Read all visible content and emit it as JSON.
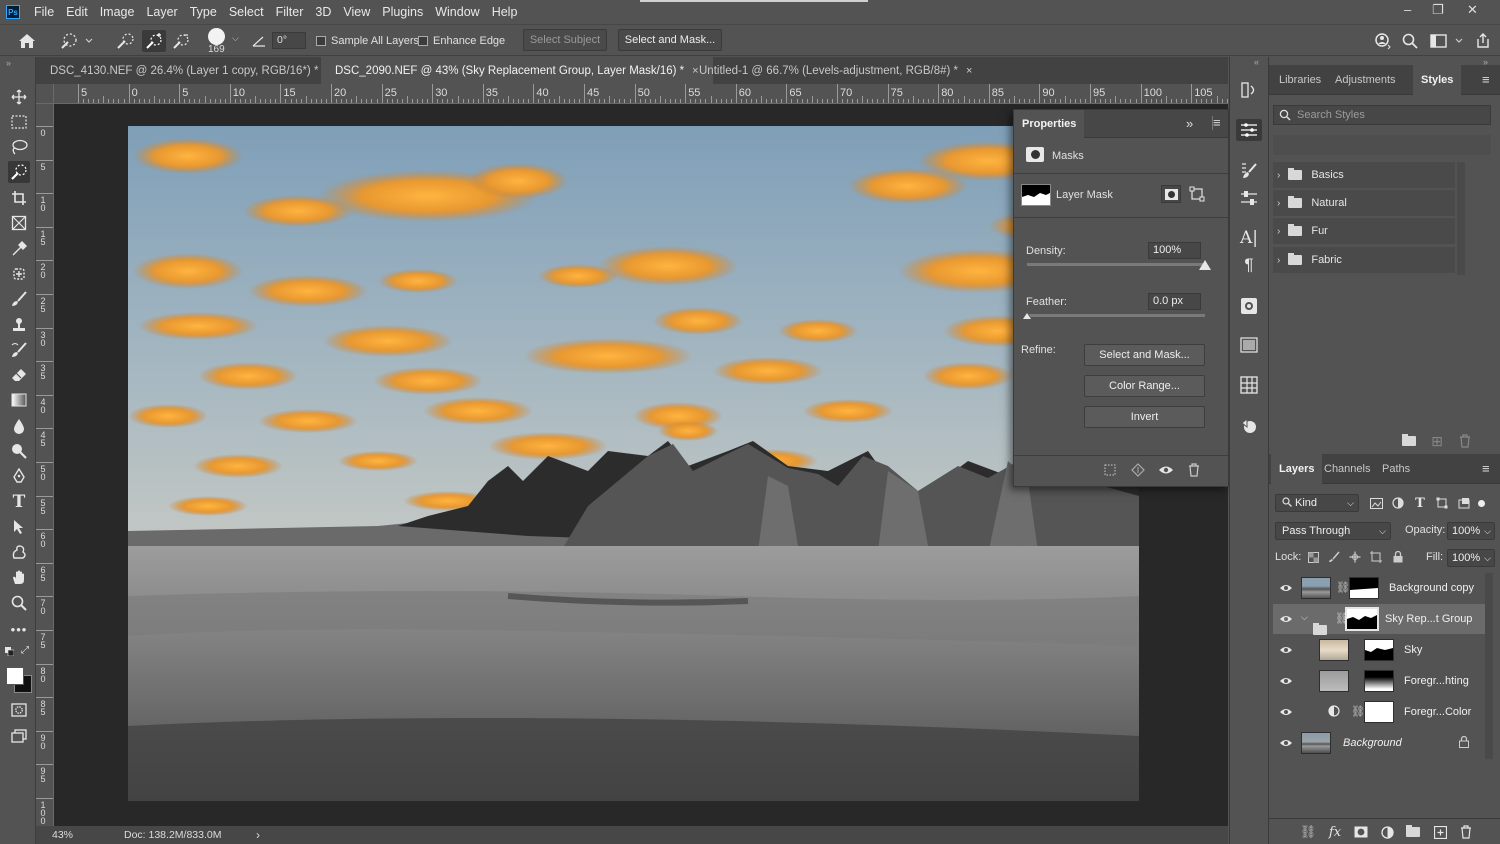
{
  "app": {
    "logo": "Ps"
  },
  "menu": [
    "File",
    "Edit",
    "Image",
    "Layer",
    "Type",
    "Select",
    "Filter",
    "3D",
    "View",
    "Plugins",
    "Window",
    "Help"
  ],
  "window_controls": {
    "minimize": "–",
    "restore": "❐",
    "close": "✕"
  },
  "options_bar": {
    "brush_size": "169",
    "angle": "0°",
    "sample_all_layers": "Sample All Layers",
    "enhance_edge": "Enhance Edge",
    "select_subject": "Select Subject",
    "select_and_mask": "Select and Mask..."
  },
  "tabs": [
    {
      "label": "DSC_4130.NEF @ 26.4% (Layer 1 copy, RGB/16*) *",
      "close": "×"
    },
    {
      "label": "DSC_2090.NEF @ 43% (Sky Replacement Group, Layer Mask/16) *",
      "close": "×"
    },
    {
      "label": "Untitled-1 @ 66.7% (Levels-adjustment, RGB/8#) *",
      "close": "×"
    }
  ],
  "ruler": {
    "h_labels": [
      "5",
      "0",
      "5",
      "10",
      "15",
      "20",
      "25",
      "30",
      "35",
      "40",
      "45",
      "50",
      "55",
      "60",
      "65",
      "70",
      "75",
      "80",
      "85",
      "90",
      "95",
      "100",
      "105"
    ],
    "v_labels": [
      "0",
      "5",
      "1 0",
      "1 5",
      "2 0",
      "2 5",
      "3 0",
      "3 5",
      "4 0",
      "4 5",
      "5 0",
      "5 5",
      "6 0",
      "6 5",
      "7 0",
      "7 5",
      "8 0",
      "8 5",
      "9 0",
      "9 5",
      "1 0 0"
    ]
  },
  "status": {
    "zoom": "43%",
    "doc": "Doc: 138.2M/833.0M",
    "arrow": "›"
  },
  "properties": {
    "title": "Properties",
    "section": "Masks",
    "layer_mask": "Layer Mask",
    "density_label": "Density:",
    "density_value": "100%",
    "density": 1.0,
    "feather_label": "Feather:",
    "feather_value": "0.0 px",
    "feather": 0.0,
    "refine_label": "Refine:",
    "btn_select_mask": "Select and Mask...",
    "btn_color_range": "Color Range...",
    "btn_invert": "Invert"
  },
  "styles_panel": {
    "tabs": [
      "Libraries",
      "Adjustments",
      "Styles"
    ],
    "search_placeholder": "Search Styles",
    "groups": [
      "Basics",
      "Natural",
      "Fur",
      "Fabric"
    ]
  },
  "layers_panel": {
    "tabs": [
      "Layers",
      "Channels",
      "Paths"
    ],
    "kind": "Kind",
    "blend_mode": "Pass Through",
    "opacity_label": "Opacity:",
    "opacity_value": "100%",
    "lock_label": "Lock:",
    "fill_label": "Fill:",
    "fill_value": "100%",
    "layers": [
      {
        "name": "Background copy"
      },
      {
        "name": "Sky Rep...t Group"
      },
      {
        "name": "Sky"
      },
      {
        "name": "Foregr...hting"
      },
      {
        "name": "Foregr...Color"
      },
      {
        "name": "Background"
      }
    ]
  },
  "colors": {
    "ui_bg": "#535353",
    "dark_bg": "#424242",
    "canvas_bg": "#282828",
    "accent": "#31a8ff"
  }
}
